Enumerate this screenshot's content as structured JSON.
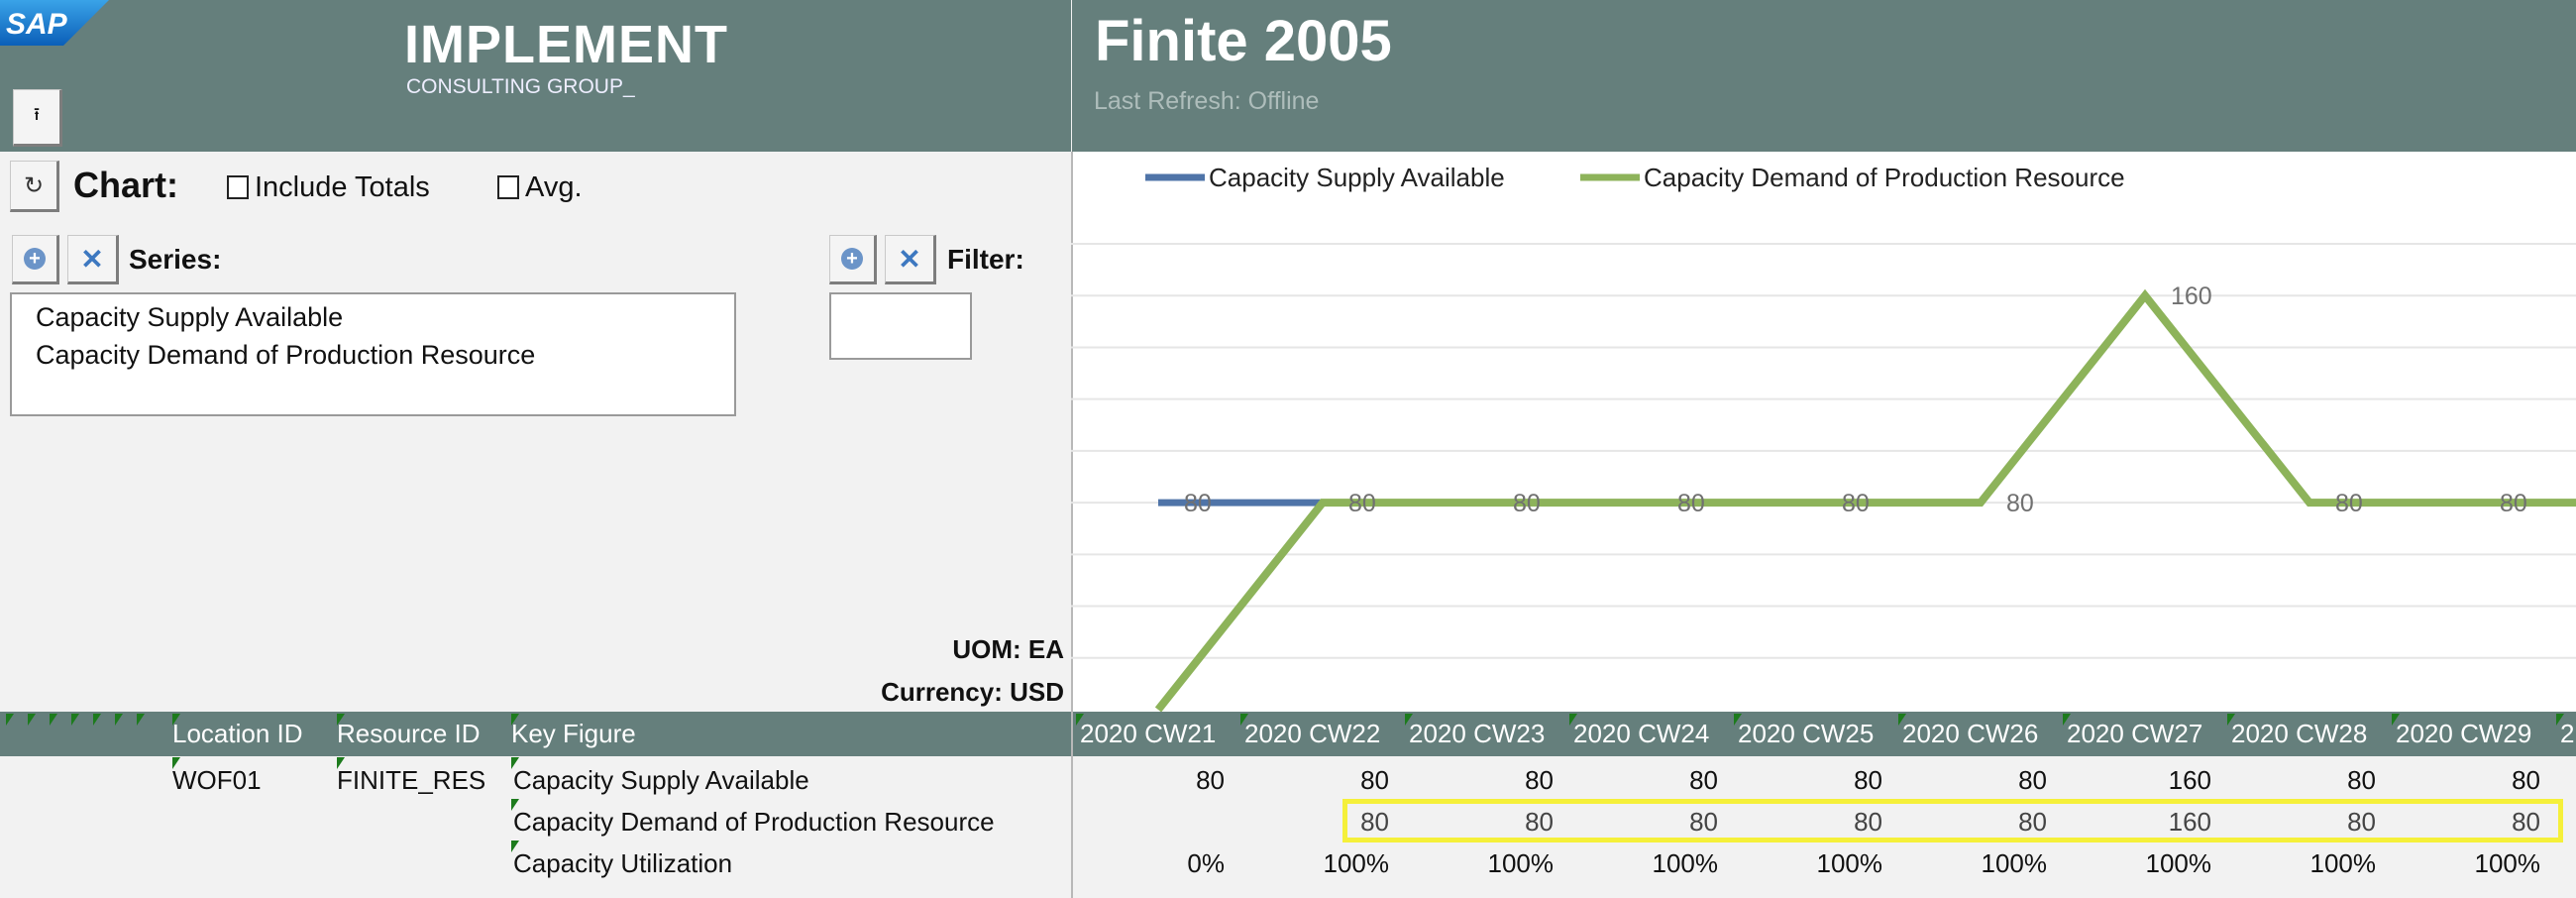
{
  "header": {
    "sap_logo": "SAP",
    "brand_title": "IMPLEMENT",
    "brand_subtitle": "CONSULTING GROUP_",
    "page_title": "Finite 2005",
    "last_refresh": "Last Refresh: Offline",
    "color": "#657f7c"
  },
  "controls": {
    "chart_label": "Chart:",
    "include_totals_label": "Include Totals",
    "include_totals_checked": false,
    "avg_label": "Avg.",
    "avg_checked": false,
    "series_label": "Series:",
    "series_items": [
      "Capacity Supply Available",
      "Capacity Demand of Production Resource"
    ],
    "filter_label": "Filter:",
    "uom": "UOM: EA",
    "currency": "Currency: USD"
  },
  "grid": {
    "headers": {
      "location": "Location ID",
      "resource": "Resource ID",
      "key_figure": "Key Figure"
    },
    "weeks": [
      "2020 CW21",
      "2020 CW22",
      "2020 CW23",
      "2020 CW24",
      "2020 CW25",
      "2020 CW26",
      "2020 CW27",
      "2020 CW28",
      "2020 CW29"
    ],
    "partial_week": "2",
    "rows": [
      {
        "location": "WOF01",
        "resource": "FINITE_RES",
        "key_figure": "Capacity Supply Available",
        "values": [
          "80",
          "80",
          "80",
          "80",
          "80",
          "80",
          "160",
          "80",
          "80"
        ]
      },
      {
        "location": "",
        "resource": "",
        "key_figure": "Capacity Demand of Production Resource",
        "values": [
          "",
          "80",
          "80",
          "80",
          "80",
          "80",
          "160",
          "80",
          "80"
        ]
      },
      {
        "location": "",
        "resource": "",
        "key_figure": "Capacity Utilization",
        "values": [
          "0%",
          "100%",
          "100%",
          "100%",
          "100%",
          "100%",
          "100%",
          "100%",
          "100%"
        ]
      }
    ],
    "highlight_color": "#f5f03a"
  },
  "chart_data": {
    "type": "line",
    "categories": [
      "2020 CW21",
      "2020 CW22",
      "2020 CW23",
      "2020 CW24",
      "2020 CW25",
      "2020 CW26",
      "2020 CW27",
      "2020 CW28",
      "2020 CW29"
    ],
    "series": [
      {
        "name": "Capacity Supply Available",
        "color": "#4f74a8",
        "values": [
          80,
          80,
          80,
          80,
          80,
          80,
          160,
          80,
          80
        ],
        "labels": [
          "80"
        ]
      },
      {
        "name": "Capacity Demand of Production Resource",
        "color": "#8db35a",
        "values": [
          0,
          80,
          80,
          80,
          80,
          80,
          160,
          80,
          80
        ],
        "labels": [
          "",
          "80",
          "80",
          "80",
          "80",
          "80",
          "160",
          "80",
          "80"
        ]
      }
    ],
    "ylim": [
      0,
      180
    ],
    "grid": true,
    "legend": "top-left",
    "xlabel": "",
    "ylabel": ""
  }
}
